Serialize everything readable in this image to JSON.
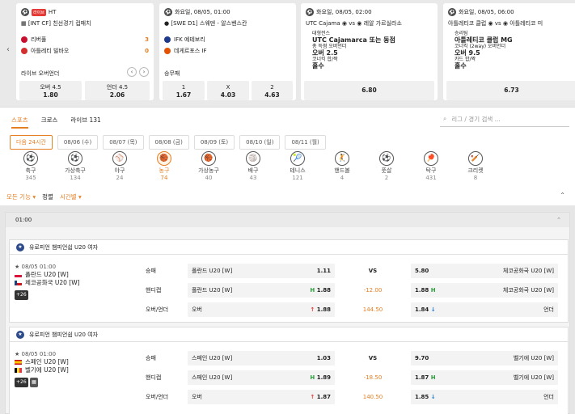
{
  "live_cards": [
    {
      "status": "HT",
      "live_badge": "라이브",
      "league": "[INT CF] 친선경기 컵매치",
      "home": "리버풀",
      "away": "아틀레티 빌바오",
      "home_score": "3",
      "away_score": "0",
      "market": "라이브 오버언더",
      "odds": [
        {
          "label": "오버 4.5",
          "value": "1.80"
        },
        {
          "label": "언더 4.5",
          "value": "2.06"
        }
      ],
      "home_color": "#c8102e",
      "away_color": "#d32f2f"
    },
    {
      "status": "화요일, 08/05, 01:00",
      "league": "[SWE D1] 스웨덴 - 알스벤스칸",
      "home": "IFK 예테보리",
      "away": "데게르포스 IF",
      "market": "승무패",
      "odds": [
        {
          "label": "1",
          "value": "1.67"
        },
        {
          "label": "X",
          "value": "4.03"
        },
        {
          "label": "2",
          "value": "4.63"
        }
      ],
      "home_color": "#1e3a8a",
      "away_color": "#e65100"
    },
    {
      "status": "화요일, 08/05, 02:00",
      "home": "UTC Cajama",
      "vs": "vs",
      "away": "레알 가르실라소",
      "lines": [
        "대형전스",
        "UTC Cajamarca 또는 동점",
        "총 득점 오버언더",
        "오버 2.5",
        "코너킥 합/짝",
        "홀수"
      ],
      "value": "6.80"
    },
    {
      "status": "화요일, 08/05, 06:00",
      "home": "아틀레티코 클럽",
      "vs": "vs",
      "away": "아틀레티코 미",
      "lines": [
        "승리팀",
        "아틀레티코 클럽 MG",
        "코너킥 (2way) 오버언더",
        "오버 9.5",
        "카드 합/짝",
        "홀수"
      ],
      "value": "6.73"
    }
  ],
  "tabs": [
    "스포츠",
    "크로스",
    "라이브 131"
  ],
  "search_placeholder": "리그 / 경기 검색 ...",
  "dates": [
    "다음 24시간",
    "08/06 (수)",
    "08/07 (목)",
    "08/08 (금)",
    "08/09 (토)",
    "08/10 (일)",
    "08/11 (월)"
  ],
  "sports": [
    {
      "name": "축구",
      "count": "345",
      "icon": "⚽"
    },
    {
      "name": "가상축구",
      "count": "134",
      "icon": "⚽"
    },
    {
      "name": "야구",
      "count": "24",
      "icon": "⚾"
    },
    {
      "name": "농구",
      "count": "74",
      "icon": "🏀"
    },
    {
      "name": "가상농구",
      "count": "40",
      "icon": "🏀"
    },
    {
      "name": "배구",
      "count": "43",
      "icon": "🏐"
    },
    {
      "name": "테니스",
      "count": "121",
      "icon": "🎾"
    },
    {
      "name": "핸드볼",
      "count": "4",
      "icon": "🤾"
    },
    {
      "name": "풋살",
      "count": "2",
      "icon": "⚽"
    },
    {
      "name": "탁구",
      "count": "431",
      "icon": "🏓"
    },
    {
      "name": "크리켓",
      "count": "8",
      "icon": "🏏"
    }
  ],
  "tools": {
    "all": "모든 기능",
    "sort_label": "정렬",
    "sort_value": "시간별"
  },
  "group_time": "01:00",
  "matches": [
    {
      "league": "유로피언 챔피언쉽 U20 여자",
      "time": "08/05 01:00",
      "home": "폴란드 U20 [W]",
      "away": "체코공화국 U20 [W]",
      "more": "+26",
      "flag_home": "#dc143c",
      "flag_away": "#11457e",
      "rows": [
        {
          "label": "승패",
          "l_name": "폴란드 U20 [W]",
          "l_val": "1.11",
          "mid": "VS",
          "r_val": "5.80",
          "r_name": "체코공화국 U20 [W]"
        },
        {
          "label": "핸디캡",
          "l_name": "폴란드 U20 [W]",
          "l_tag": "H",
          "l_val": "1.88",
          "mid": "-12.00",
          "r_val": "1.88",
          "r_tag": "H",
          "r_name": "체코공화국 U20 [W]"
        },
        {
          "label": "오버/언더",
          "l_name": "오버",
          "l_val": "1.88",
          "mid": "144.50",
          "r_val": "1.84",
          "r_name": "언더"
        }
      ]
    },
    {
      "league": "유로피언 챔피언쉽 U20 여자",
      "time": "08/05 01:00",
      "home": "스페인 U20 [W]",
      "away": "벨기에 U20 [W]",
      "more": "+26",
      "flag_home": "#c60b1e",
      "flag_away": "#fdda24",
      "rows": [
        {
          "label": "승패",
          "l_name": "스페인 U20 [W]",
          "l_val": "1.03",
          "mid": "VS",
          "r_val": "9.70",
          "r_name": "벨기에 U20 [W]"
        },
        {
          "label": "핸디캡",
          "l_name": "스페인 U20 [W]",
          "l_tag": "H",
          "l_val": "1.89",
          "mid": "-18.50",
          "r_val": "1.87",
          "r_tag": "H",
          "r_name": "벨기에 U20 [W]"
        },
        {
          "label": "오버/언더",
          "l_name": "오버",
          "l_val": "1.87",
          "mid": "140.50",
          "r_val": "1.85",
          "r_name": "언더"
        }
      ]
    }
  ]
}
